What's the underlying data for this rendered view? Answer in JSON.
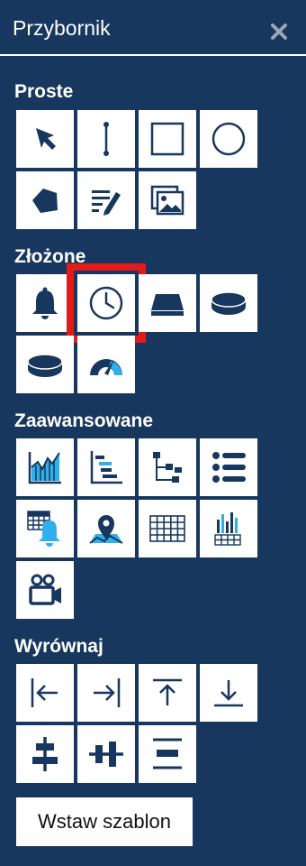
{
  "panel": {
    "title": "Przybornik"
  },
  "sections": {
    "basic": {
      "title": "Proste"
    },
    "complex": {
      "title": "Złożone"
    },
    "advanced": {
      "title": "Zaawansowane"
    },
    "align": {
      "title": "Wyrównaj"
    }
  },
  "buttons": {
    "insert_template": "Wstaw szablon"
  },
  "colors": {
    "panel_background": "#17375e",
    "tile_background": "#ffffff",
    "icon_primary": "#17375e",
    "icon_accent": "#2fb0ec",
    "selection_border": "#e21a1a"
  },
  "icons": {
    "basic": [
      "pointer-icon",
      "line-icon",
      "rectangle-icon",
      "circle-icon",
      "polygon-icon",
      "text-icon",
      "image-icon"
    ],
    "complex": [
      "bell-icon",
      "clock-icon",
      "plate-icon",
      "disc-icon",
      "disc-small-icon",
      "gauge-icon"
    ],
    "advanced": [
      "area-chart-icon",
      "gantt-chart-icon",
      "tree-icon",
      "list-icon",
      "grid-bell-icon",
      "map-pin-icon",
      "table-icon",
      "bar-grid-icon",
      "camera-icon"
    ],
    "align": [
      "align-left-icon",
      "align-right-icon",
      "align-top-icon",
      "align-bottom-icon",
      "align-vertical-center-icon",
      "align-horizontal-center-icon",
      "distribute-icon"
    ]
  },
  "selected_tool": "clock-icon"
}
